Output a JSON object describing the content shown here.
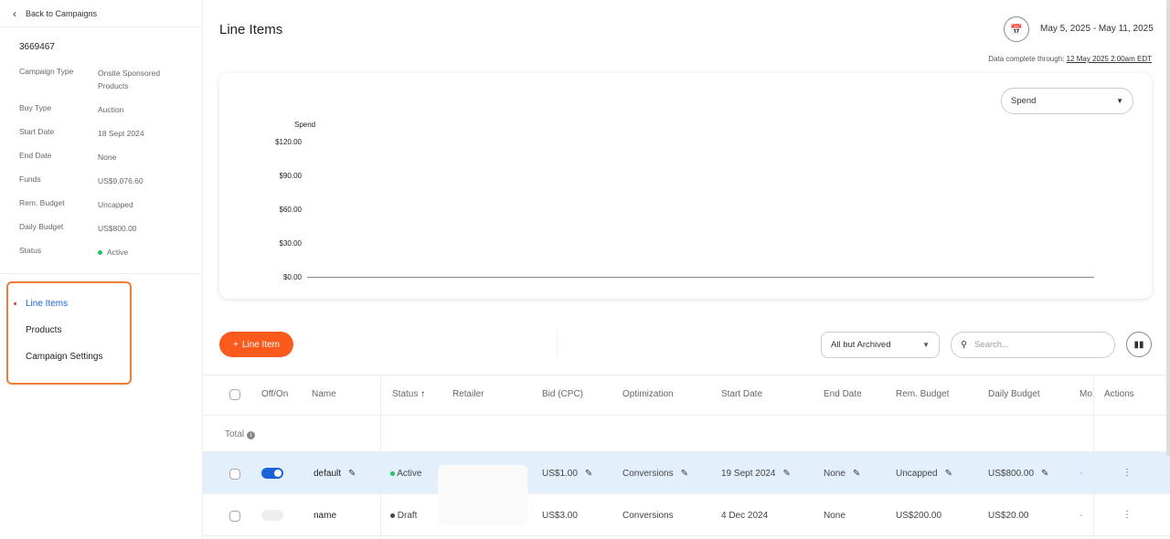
{
  "sidebar": {
    "back_label": "Back to Campaigns",
    "campaign_id": "3669467",
    "info": [
      {
        "label": "Campaign Type",
        "value": "Onsite Sponsored Products"
      },
      {
        "label": "Buy Type",
        "value": "Auction"
      },
      {
        "label": "Start Date",
        "value": "18 Sept 2024"
      },
      {
        "label": "End Date",
        "value": "None"
      },
      {
        "label": "Funds",
        "value": "US$9,076.60"
      },
      {
        "label": "Rem. Budget",
        "value": "Uncapped"
      },
      {
        "label": "Daily Budget",
        "value": "US$800.00"
      },
      {
        "label": "Status",
        "value": "Active"
      }
    ],
    "nav": [
      {
        "label": "Line Items"
      },
      {
        "label": "Products"
      },
      {
        "label": "Campaign Settings"
      }
    ]
  },
  "header": {
    "title": "Line Items",
    "date_range": "May 5, 2025 - May 11, 2025",
    "data_complete_label": "Data complete through:",
    "data_complete_value": "12 May 2025 2:00am EDT"
  },
  "chart": {
    "metric_select": "Spend",
    "ylabel": "Spend",
    "yticks": [
      "$120.00",
      "$90.00",
      "$60.00",
      "$30.00",
      "$0.00"
    ]
  },
  "chart_data": {
    "type": "line",
    "title": "",
    "ylabel": "Spend",
    "ylim": [
      0,
      120
    ],
    "series": [
      {
        "name": "Spend",
        "values": [
          0
        ]
      }
    ]
  },
  "toolbar": {
    "add_label": "Line Item",
    "filter": "All but Archived",
    "search_placeholder": "Search..."
  },
  "table": {
    "headers": [
      "Off/On",
      "Name",
      "Status",
      "Retailer",
      "Bid (CPC)",
      "Optimization",
      "Start Date",
      "End Date",
      "Rem. Budget",
      "Daily Budget",
      "Mo",
      "Actions"
    ],
    "total_label": "Total",
    "rows": [
      {
        "name": "default",
        "status": "Active",
        "bid": "US$1.00",
        "optimization": "Conversions",
        "start": "19 Sept 2024",
        "end": "None",
        "rem": "Uncapped",
        "daily": "US$800.00",
        "mo": "-",
        "on": true
      },
      {
        "name": "name",
        "status": "Draft",
        "bid": "US$3.00",
        "optimization": "Conversions",
        "start": "4 Dec 2024",
        "end": "None",
        "rem": "US$200.00",
        "daily": "US$20.00",
        "mo": "-",
        "on": false
      }
    ]
  },
  "colors": {
    "accent": "#fa5a1b",
    "active": "#22c55e",
    "link": "#1a63d8",
    "row_highlight": "#e3f0fc"
  }
}
